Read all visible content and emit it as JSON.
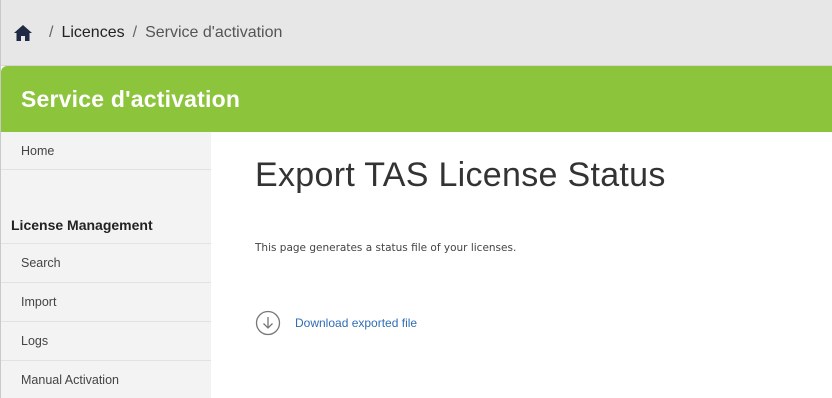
{
  "breadcrumb": {
    "home_icon": "home-icon",
    "separator": "/",
    "items": [
      {
        "label": "Licences"
      },
      {
        "label": "Service d'activation"
      }
    ]
  },
  "header": {
    "title": "Service d'activation",
    "color": "#8cc43c"
  },
  "sidebar": {
    "home": "Home",
    "section_title": "License Management",
    "items": [
      {
        "label": "Search"
      },
      {
        "label": "Import"
      },
      {
        "label": "Logs"
      },
      {
        "label": "Manual Activation"
      }
    ]
  },
  "main": {
    "title": "Export TAS License Status",
    "description": "This page generates a status file of your licenses.",
    "download": {
      "icon": "download-icon",
      "label": "Download exported file",
      "link_color": "#2f6db5"
    }
  }
}
